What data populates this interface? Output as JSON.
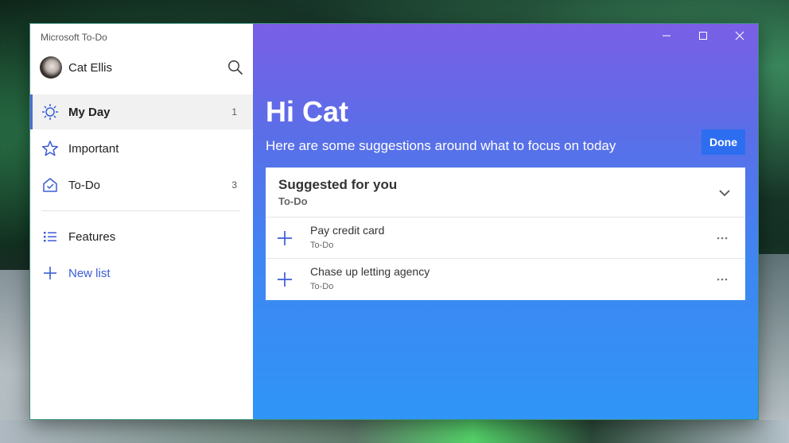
{
  "window": {
    "app_title": "Microsoft To-Do"
  },
  "user": {
    "name": "Cat Ellis"
  },
  "nav": {
    "items": [
      {
        "label": "My Day",
        "count": "1",
        "icon": "sun-icon"
      },
      {
        "label": "Important",
        "count": "",
        "icon": "star-icon"
      },
      {
        "label": "To-Do",
        "count": "3",
        "icon": "house-check-icon"
      }
    ],
    "features_label": "Features",
    "new_list_label": "New list"
  },
  "main": {
    "greeting": "Hi Cat",
    "subtitle": "Here are some suggestions around what to focus on today",
    "done_label": "Done",
    "suggestions": {
      "title": "Suggested for you",
      "subtitle": "To-Do",
      "tasks": [
        {
          "title": "Pay credit card",
          "list": "To-Do"
        },
        {
          "title": "Chase up letting agency",
          "list": "To-Do"
        }
      ]
    }
  },
  "colors": {
    "accent": "#4f6bd8",
    "done_button": "#2d6ef0",
    "gradient_top": "#7a5fe6",
    "gradient_bottom": "#2f95f6"
  }
}
